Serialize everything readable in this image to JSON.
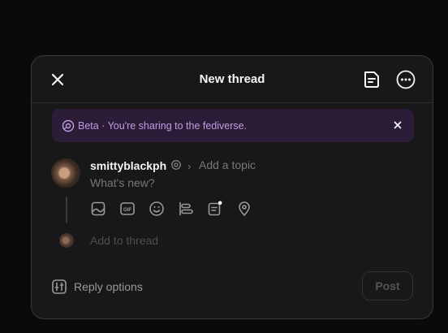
{
  "modal": {
    "title": "New thread",
    "close_icon": "close-icon",
    "drafts_icon": "drafts-icon",
    "more_icon": "more-options-icon"
  },
  "banner": {
    "text": "Beta · You're sharing to the fediverse.",
    "icon": "fediverse-icon",
    "close_icon": "close-icon",
    "bg_color": "#2b1c37",
    "text_color": "#c29be0"
  },
  "composer": {
    "username": "smittyblackph",
    "topic_placeholder": "Add a topic",
    "body_placeholder": "What's new?",
    "tools": [
      "media-icon",
      "gif-icon",
      "emoji-icon",
      "poll-icon",
      "drafts-icon",
      "location-icon"
    ],
    "add_to_thread": "Add to thread"
  },
  "footer": {
    "reply_options": "Reply options",
    "post": "Post"
  }
}
